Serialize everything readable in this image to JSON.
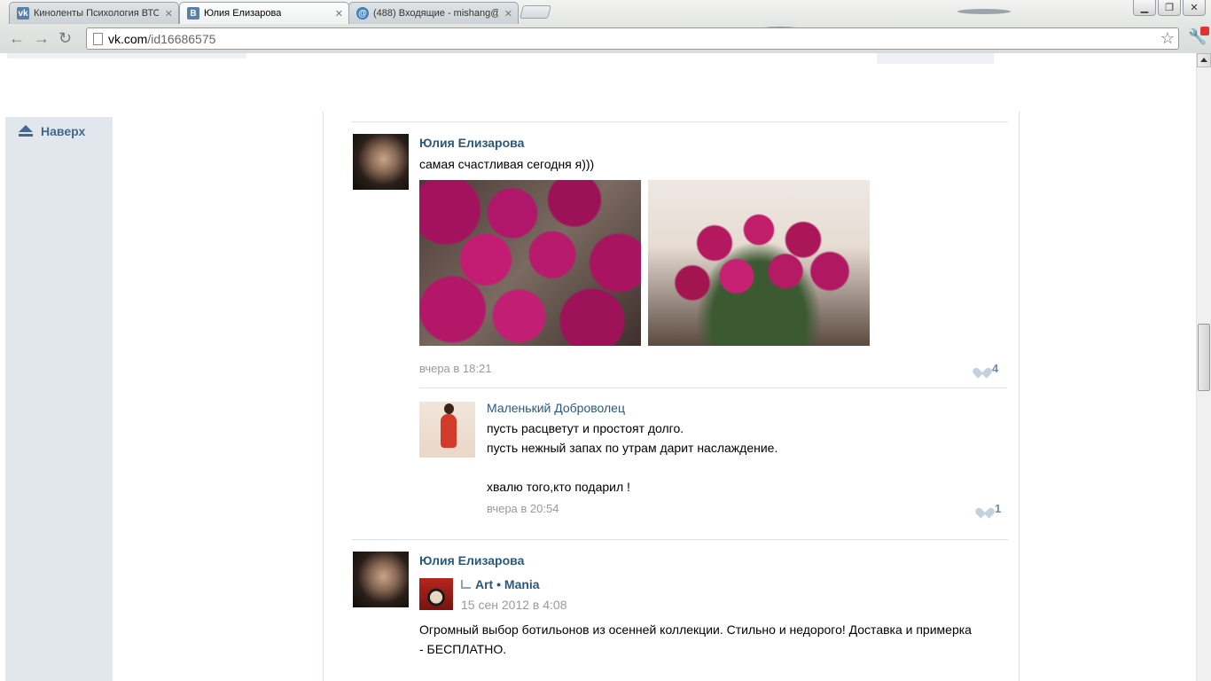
{
  "browser": {
    "tabs": [
      {
        "title": "Киноленты Психология ВТО",
        "favicon": "vk-icon"
      },
      {
        "title": "Юлия Елизарова",
        "favicon": "vk-icon"
      },
      {
        "title": "(488) Входящие - mishang@",
        "favicon": "mail-icon"
      }
    ],
    "address": {
      "host": "vk.com",
      "path": "/id16686575"
    }
  },
  "sidebar": {
    "to_top_label": "Наверх"
  },
  "posts": [
    {
      "author": "Юлия Елизарова",
      "text": "самая счастливая сегодня я)))",
      "time": "вчера в 18:21",
      "likes": "4",
      "comment": {
        "author": "Маленький Доброволец",
        "lines": [
          "пусть расцветут и простоят долго.",
          "пусть нежный запах по утрам дарит наслаждение.",
          "",
          "хвалю того,кто подарил !"
        ],
        "time": "вчера в 20:54",
        "likes": "1"
      }
    },
    {
      "author": "Юлия Елизарова",
      "repost": {
        "group": "Art • Mania",
        "time": "15 сен 2012 в 4:08",
        "text_lines": [
          "Огромный выбор ботильонов из осенней коллекции. Стильно и недорого! Доставка и примерка",
          "- БЕСПЛАТНО."
        ]
      }
    }
  ],
  "colors": {
    "link": "#2b587a",
    "sidebar_bg": "#e1e7ed",
    "muted": "#999999",
    "like": "#6d8aad"
  }
}
